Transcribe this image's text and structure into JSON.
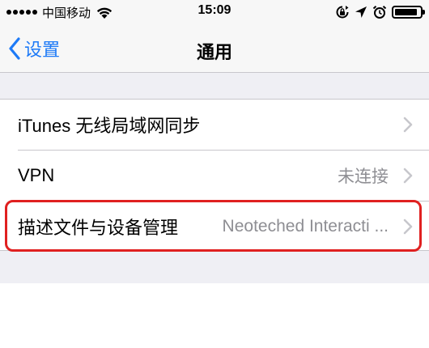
{
  "status_bar": {
    "carrier": "中国移动",
    "time": "15:09"
  },
  "nav": {
    "back_label": "设置",
    "title": "通用"
  },
  "rows": [
    {
      "label": "iTunes 无线局域网同步",
      "value": ""
    },
    {
      "label": "VPN",
      "value": "未连接"
    },
    {
      "label": "描述文件与设备管理",
      "value": "Neoteched Interacti ..."
    }
  ],
  "colors": {
    "accent": "#1d7af7",
    "highlight": "#e02020",
    "group_background": "#efeff4",
    "secondary_text": "#8e8e93"
  },
  "icons": [
    "wifi-icon",
    "orientation-lock-icon",
    "location-icon",
    "alarm-icon",
    "battery-icon",
    "chevron-left-icon",
    "chevron-right-icon"
  ]
}
